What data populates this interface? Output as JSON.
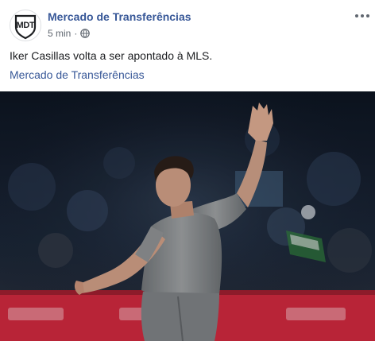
{
  "post": {
    "avatar_text": "MDT",
    "page_name": "Mercado de Transferências",
    "time": "5 min",
    "separator": "·",
    "privacy_icon": "globe-icon",
    "more_icon": "more-options-icon",
    "text": "Iker Casillas volta a ser apontado à MLS.",
    "link_text": "Mercado de Transferências",
    "photo_description_icon": "post-photo"
  },
  "colors": {
    "link": "#385898",
    "text": "#1c1e21",
    "secondary": "#606770",
    "stadium_red": "#c8283c",
    "shirt_gray": "#8c8f91"
  }
}
